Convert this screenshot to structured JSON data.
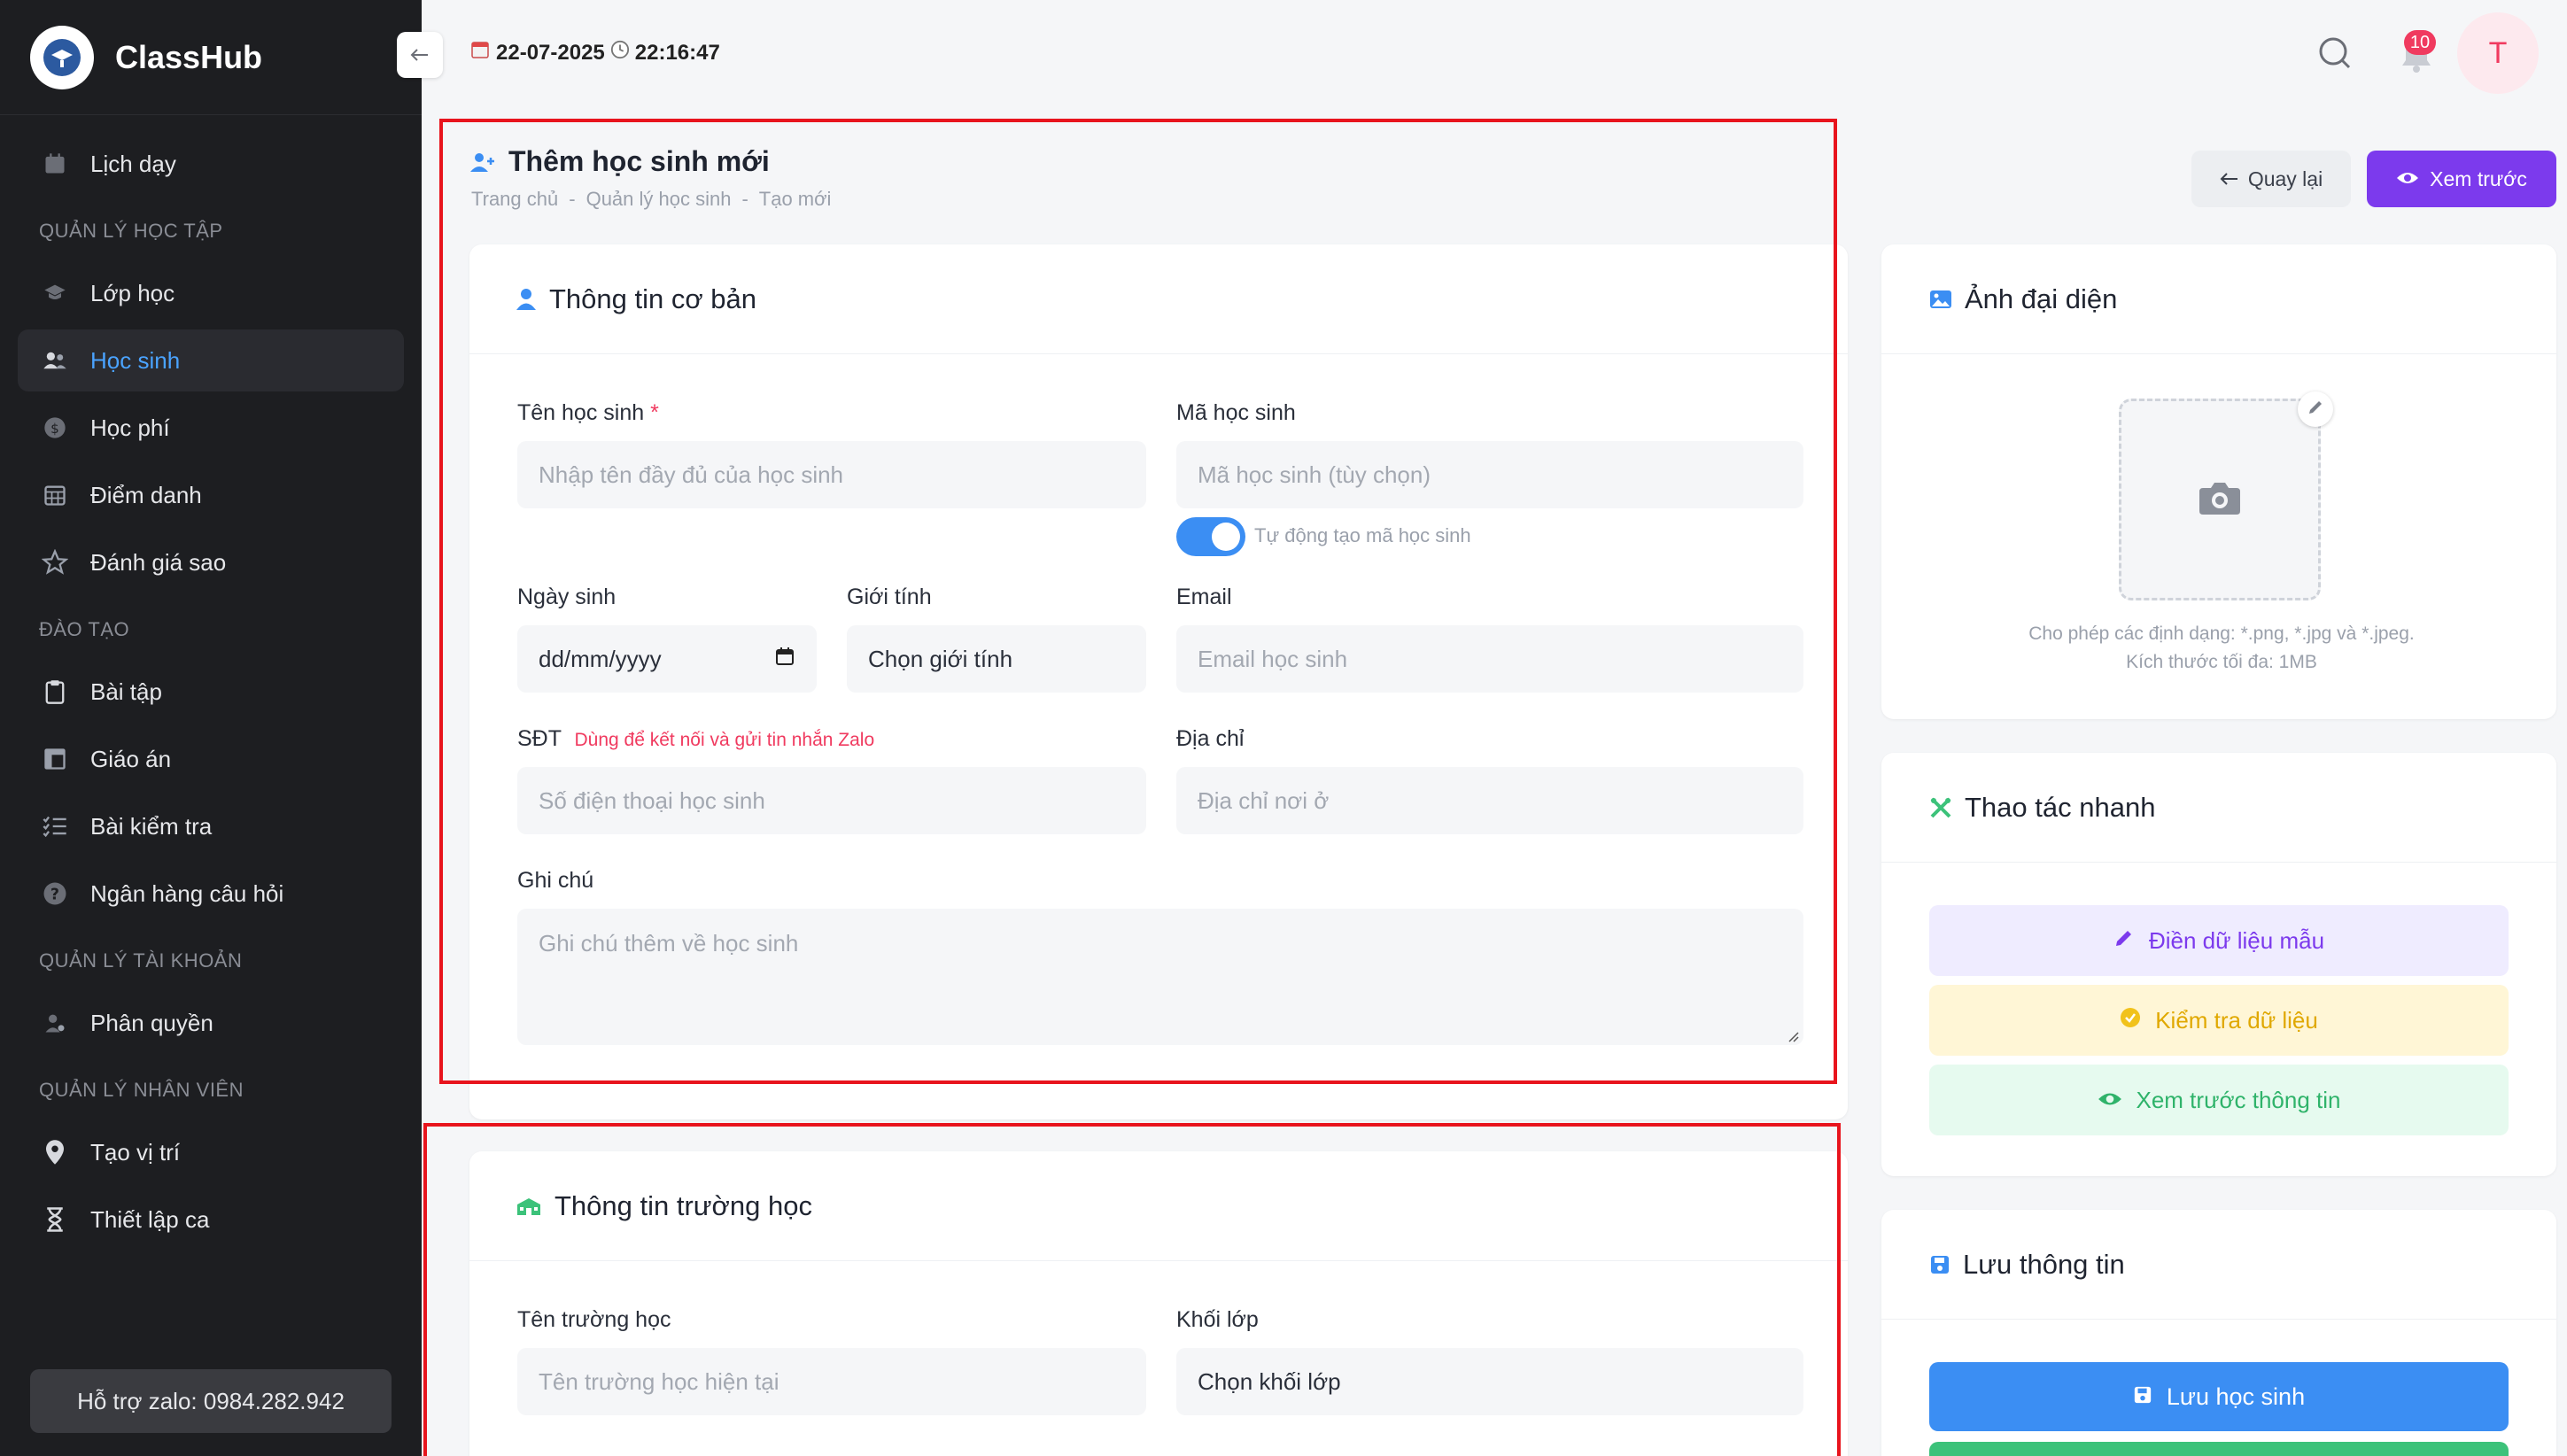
{
  "app": {
    "name": "ClassHub"
  },
  "sidebar": {
    "items": [
      {
        "label": "Lịch dạy",
        "icon": "calendar-icon"
      },
      {
        "section": "QUẢN LÝ HỌC TẬP"
      },
      {
        "label": "Lớp học",
        "icon": "class-icon"
      },
      {
        "label": "Học sinh",
        "icon": "students-icon",
        "active": true
      },
      {
        "label": "Học phí",
        "icon": "dollar-icon"
      },
      {
        "label": "Điểm danh",
        "icon": "attendance-icon"
      },
      {
        "label": "Đánh giá sao",
        "icon": "star-icon"
      },
      {
        "section": "ĐÀO TẠO"
      },
      {
        "label": "Bài tập",
        "icon": "clipboard-icon"
      },
      {
        "label": "Giáo án",
        "icon": "lesson-plan-icon"
      },
      {
        "label": "Bài kiểm tra",
        "icon": "checklist-icon"
      },
      {
        "label": "Ngân hàng câu hỏi",
        "icon": "question-icon"
      },
      {
        "section": "QUẢN LÝ TÀI KHOẢN"
      },
      {
        "label": "Phân quyền",
        "icon": "user-permission-icon"
      },
      {
        "section": "QUẢN LÝ NHÂN VIÊN"
      },
      {
        "label": "Tạo vị trí",
        "icon": "location-icon"
      },
      {
        "label": "Thiết lập ca",
        "icon": "hourglass-icon"
      }
    ],
    "support": "Hỗ trợ zalo: 0984.282.942"
  },
  "topbar": {
    "date": "22-07-2025",
    "time": "22:16:47",
    "notification_count": "10",
    "avatar_initial": "T"
  },
  "page": {
    "title": "Thêm học sinh mới",
    "breadcrumb": [
      "Trang chủ",
      "-",
      "Quản lý học sinh",
      "-",
      "Tạo mới"
    ]
  },
  "basic_info": {
    "title": "Thông tin cơ bản",
    "name_label": "Tên học sinh",
    "name_required": "*",
    "name_placeholder": "Nhập tên đầy đủ của học sinh",
    "code_label": "Mã học sinh",
    "code_placeholder": "Mã học sinh (tùy chọn)",
    "auto_code_label": "Tự động tạo mã học sinh",
    "dob_label": "Ngày sinh",
    "dob_value": "dd/mm/yyyy",
    "gender_label": "Giới tính",
    "gender_value": "Chọn giới tính",
    "email_label": "Email",
    "email_placeholder": "Email học sinh",
    "phone_label": "SĐT",
    "phone_hint": "Dùng để kết nối và gửi tin nhắn Zalo",
    "phone_placeholder": "Số điện thoại học sinh",
    "address_label": "Địa chỉ",
    "address_placeholder": "Địa chỉ nơi ở",
    "note_label": "Ghi chú",
    "note_placeholder": "Ghi chú thêm về học sinh"
  },
  "school_info": {
    "title": "Thông tin trường học",
    "school_label": "Tên trường học",
    "school_placeholder": "Tên trường học hiện tại",
    "grade_label": "Khối lớp",
    "grade_value": "Chọn khối lớp"
  },
  "actions": {
    "back": "Quay lại",
    "preview": "Xem trước"
  },
  "avatar_card": {
    "title": "Ảnh đại diện",
    "hint_formats": "Cho phép các định dạng: *.png, *.jpg và *.jpeg.",
    "hint_size": "Kích thước tối đa: 1MB"
  },
  "quick_actions": {
    "title": "Thao tác nhanh",
    "fill_sample": "Điền dữ liệu mẫu",
    "check_data": "Kiểm tra dữ liệu",
    "preview_info": "Xem trước thông tin"
  },
  "save_card": {
    "title": "Lưu thông tin",
    "save_button": "Lưu học sinh"
  },
  "colors": {
    "accent_blue": "#3b8ef3",
    "purple": "#7c3aed",
    "danger": "#f03a5f",
    "highlight_red": "#e8141d"
  }
}
